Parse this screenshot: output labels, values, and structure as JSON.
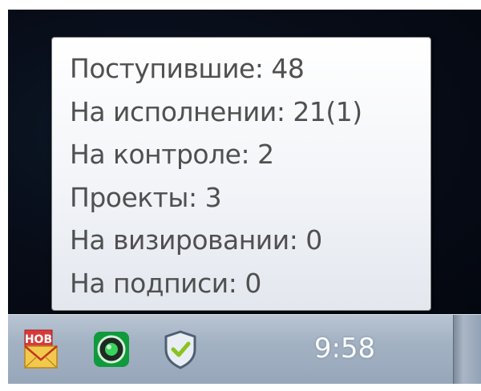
{
  "tooltip": {
    "lines": [
      "Поступившие: 48",
      "На исполнении: 21(1)",
      "На контроле: 2",
      "Проекты: 3",
      "На визировании: 0",
      "На подписи: 0"
    ]
  },
  "tray": {
    "hob_icon_label": "НОВ",
    "clock": "9:58",
    "icons": [
      "mail-hob-icon",
      "green-circle-app-icon",
      "shield-check-icon"
    ]
  },
  "colors": {
    "taskbar": "#a3b2c3",
    "tooltip_text": "#505050",
    "hob_badge": "#d83a3a",
    "envelope": "#f2c94c",
    "green_app": "#0f9a3c",
    "shield_check": "#8cc21f"
  }
}
